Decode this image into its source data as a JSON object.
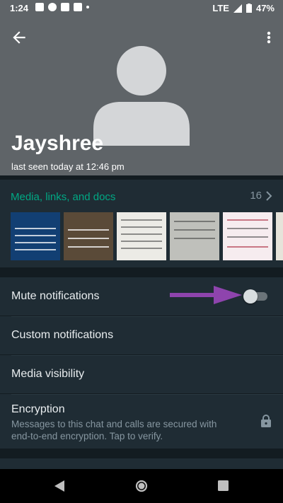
{
  "status_bar": {
    "time": "1:24",
    "network": "LTE",
    "battery": "47%"
  },
  "contact": {
    "name": "Jayshree",
    "last_seen": "last seen today at 12:46 pm"
  },
  "media": {
    "title": "Media, links, and docs",
    "count": "16"
  },
  "settings": {
    "mute": {
      "label": "Mute notifications",
      "enabled": false
    },
    "custom": {
      "label": "Custom notifications"
    },
    "visibility": {
      "label": "Media visibility"
    },
    "encryption": {
      "title": "Encryption",
      "description": "Messages to this chat and calls are secured with end-to-end encryption. Tap to verify."
    }
  },
  "colors": {
    "accent": "#00a884",
    "header": "#5f6468",
    "background": "#131c21",
    "arrow": "#8e44ad"
  },
  "icons": {
    "back": "arrow-left",
    "more": "vertical-dots",
    "media_more": "chevron-right",
    "encryption": "lock",
    "annotation": "purple-arrow-right"
  }
}
